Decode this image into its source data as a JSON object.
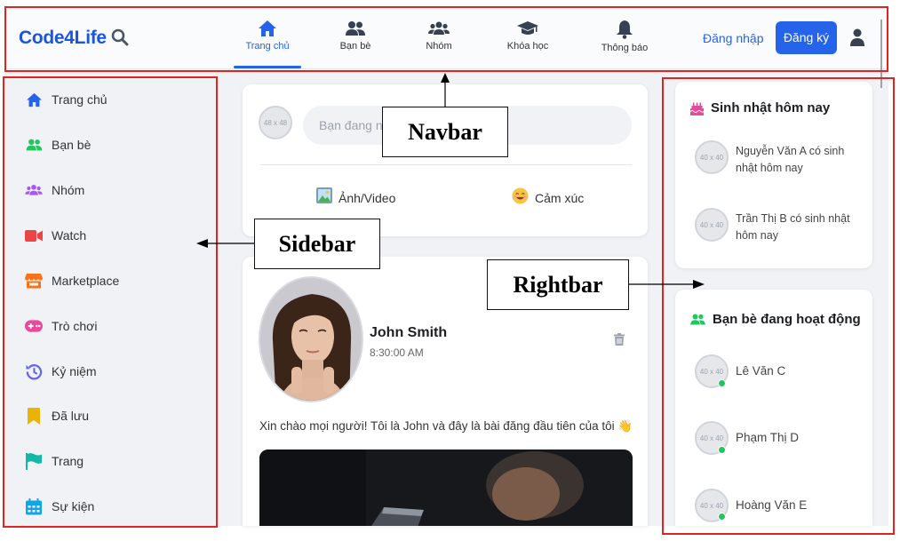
{
  "navbar": {
    "logo": "Code4Life",
    "items": [
      {
        "label": "Trang chủ",
        "icon": "home-icon",
        "active": true
      },
      {
        "label": "Bạn bè",
        "icon": "friends-icon"
      },
      {
        "label": "Nhóm",
        "icon": "groups-icon"
      },
      {
        "label": "Khóa học",
        "icon": "graduation-cap-icon"
      },
      {
        "label": "Thông báo",
        "icon": "bell-icon"
      }
    ],
    "login_label": "Đăng nhập",
    "signup_label": "Đăng ký"
  },
  "sidebar": {
    "items": [
      {
        "label": "Trang chủ",
        "icon": "home-icon",
        "color": "#2563eb"
      },
      {
        "label": "Bạn bè",
        "icon": "friends-icon",
        "color": "#22c55e"
      },
      {
        "label": "Nhóm",
        "icon": "groups-icon",
        "color": "#a855f7"
      },
      {
        "label": "Watch",
        "icon": "video-icon",
        "color": "#ef4444"
      },
      {
        "label": "Marketplace",
        "icon": "store-icon",
        "color": "#f97316"
      },
      {
        "label": "Trò chơi",
        "icon": "gamepad-icon",
        "color": "#ec4899"
      },
      {
        "label": "Kỷ niệm",
        "icon": "history-icon",
        "color": "#6366f1"
      },
      {
        "label": "Đã lưu",
        "icon": "bookmark-icon",
        "color": "#eab308"
      },
      {
        "label": "Trang",
        "icon": "flag-icon",
        "color": "#14b8a6"
      },
      {
        "label": "Sự kiện",
        "icon": "calendar-icon",
        "color": "#0ea5e9"
      }
    ]
  },
  "composer": {
    "avatar_text": "48 x 48",
    "placeholder": "Bạn đang ng",
    "actions": [
      {
        "label": "Ảnh/Video",
        "icon": "photo-icon"
      },
      {
        "label": "Cảm xúc",
        "icon": "smile-icon"
      }
    ]
  },
  "post": {
    "author": "John Smith",
    "time": "8:30:00 AM",
    "text": "Xin chào mọi người! Tôi là John và đây là bài đăng đầu tiên của tôi 👋"
  },
  "rightbar": {
    "birthdays": {
      "title": "Sinh nhật hôm nay",
      "items": [
        {
          "avatar_text": "40 x 40",
          "text": "Nguyễn Văn A có sinh nhật hôm nay"
        },
        {
          "avatar_text": "40 x 40",
          "text": "Trần Thị B có sinh nhật hôm nay"
        }
      ]
    },
    "online": {
      "title": "Bạn bè đang hoạt động",
      "items": [
        {
          "avatar_text": "40 x 40",
          "name": "Lê Văn C"
        },
        {
          "avatar_text": "40 x 40",
          "name": "Phạm Thị D"
        },
        {
          "avatar_text": "40 x 40",
          "name": "Hoàng Văn E"
        }
      ]
    }
  },
  "annotations": {
    "navbar_label": "Navbar",
    "sidebar_label": "Sidebar",
    "rightbar_label": "Rightbar",
    "frame_color": "#e02424"
  }
}
